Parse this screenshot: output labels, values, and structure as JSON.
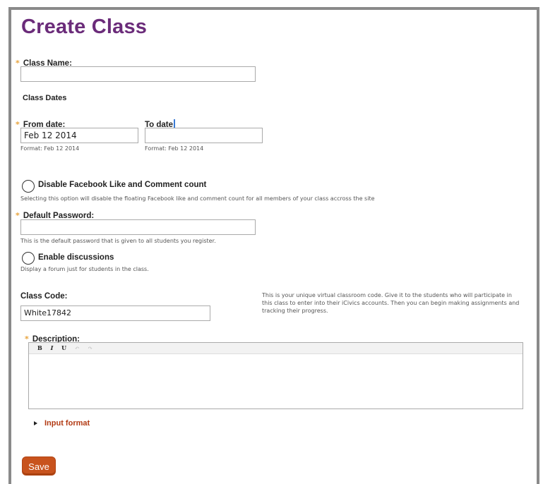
{
  "page": {
    "title": "Create Class"
  },
  "class_name": {
    "label": "Class Name:",
    "value": ""
  },
  "class_dates": {
    "heading": "Class Dates",
    "from": {
      "label": "From date:",
      "value": "Feb 12 2014",
      "hint": "Format: Feb 12 2014"
    },
    "to": {
      "label": "To date",
      "value": "",
      "hint": "Format: Feb 12 2014"
    }
  },
  "facebook": {
    "label": "Disable Facebook Like and Comment count",
    "description": "Selecting this option will disable the floating Facebook like and comment count for all members of your class accross the site"
  },
  "default_password": {
    "label": "Default Password:",
    "value": "",
    "hint": "This is the default password that is given to all students you register."
  },
  "discussions": {
    "label": "Enable discussions",
    "description": "Display a forum just for students in the class."
  },
  "class_code": {
    "label": "Class Code:",
    "value": "White17842",
    "help": "This is your unique virtual classroom code. Give it to the students who will participate in this class to enter into their iCivics accounts. Then you can begin making assignments and tracking their progress."
  },
  "description": {
    "label": "Description:",
    "toolbar": {
      "bold": "B",
      "italic": "I",
      "underline": "U",
      "undo": "↶",
      "redo": "↷"
    }
  },
  "input_format": {
    "label": "Input format"
  },
  "actions": {
    "save": "Save"
  },
  "required_marker": "*"
}
